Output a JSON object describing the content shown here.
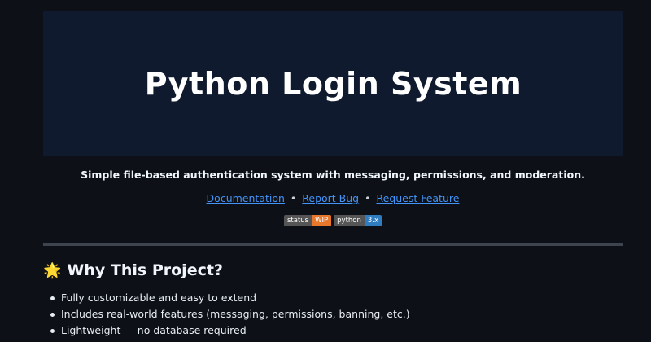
{
  "banner": {
    "title": "Python Login System"
  },
  "tagline": "Simple file-based authentication system with messaging, permissions, and moderation.",
  "links": {
    "documentation": "Documentation",
    "separator1": "•",
    "report_bug": "Report Bug",
    "separator2": "•",
    "request_feature": "Request Feature"
  },
  "badges": [
    {
      "label": "status",
      "value": "WIP",
      "color": "#e8772e"
    },
    {
      "label": "python",
      "value": "3.x",
      "color": "#2f7cc1"
    }
  ],
  "section": {
    "icon": "star-icon",
    "icon_glyph": "🌟",
    "heading": "Why This Project?"
  },
  "features": [
    "Fully customizable and easy to extend",
    "Includes real-world features (messaging, permissions, banning, etc.)",
    "Lightweight — no database required"
  ]
}
